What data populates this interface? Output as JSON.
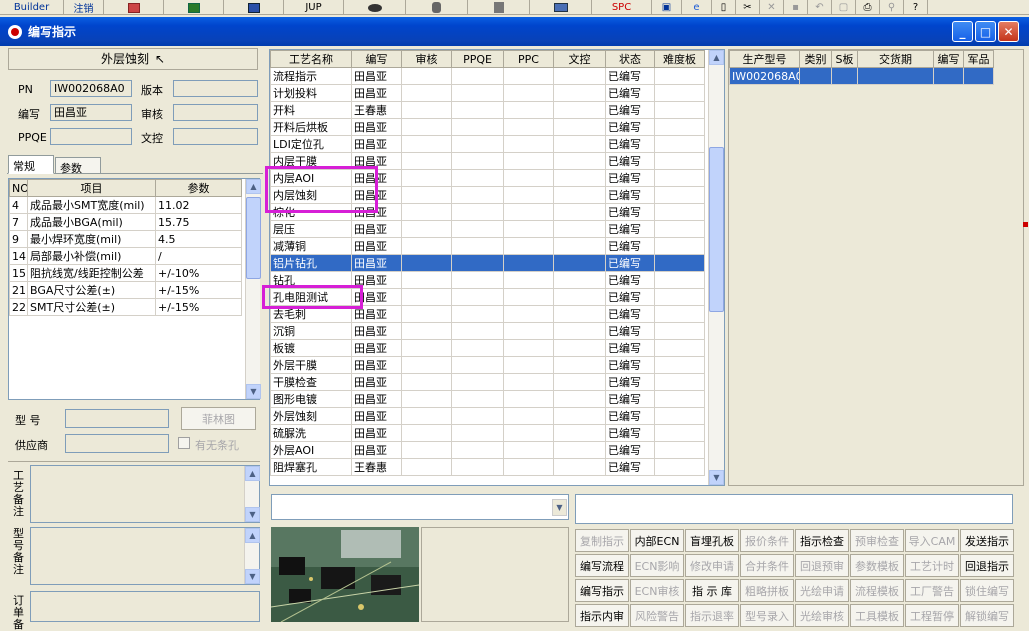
{
  "toolbar": {
    "items": [
      "Builder",
      "注销",
      "",
      "",
      "",
      "JUP",
      "",
      "",
      "",
      "",
      "SPC",
      "",
      "",
      "",
      "",
      "",
      "",
      "",
      "",
      "",
      "",
      ""
    ]
  },
  "window": {
    "title": "编写指示"
  },
  "left": {
    "header": "外层蚀刻",
    "pn_label": "PN",
    "pn_value": "IW002068A0",
    "version_label": "版本",
    "version_value": "",
    "writer_label": "编写",
    "writer_value": "田昌亚",
    "review_label": "审核",
    "review_value": "",
    "ppqe_label": "PPQE",
    "ppqe_value": "",
    "textctl_label": "文控",
    "textctl_value": "",
    "tabs": [
      "常规",
      "参数"
    ],
    "param_headers": [
      "NO",
      "项目",
      "参数"
    ],
    "params": [
      {
        "no": "4",
        "item": "成品最小SMT宽度(mil)",
        "value": "11.02"
      },
      {
        "no": "7",
        "item": "成品最小BGA(mil)",
        "value": "15.75"
      },
      {
        "no": "9",
        "item": "最小焊环宽度(mil)",
        "value": "4.5"
      },
      {
        "no": "14",
        "item": "局部最小补偿(mil)",
        "value": "/"
      },
      {
        "no": "15",
        "item": "阻抗线宽/线距控制公差",
        "value": "+/-10%"
      },
      {
        "no": "21",
        "item": "BGA尺寸公差(±)",
        "value": "+/-15%"
      },
      {
        "no": "22",
        "item": "SMT尺寸公差(±)",
        "value": "+/-15%"
      }
    ],
    "model_label": "型  号",
    "model_value": "",
    "feilin_button": "菲林图",
    "supplier_label": "供应商",
    "supplier_value": "",
    "barcode_label": "有无条孔",
    "memo1_label": "工艺备注",
    "memo2_label": "型号备注",
    "memo3_label": "订单备"
  },
  "process": {
    "headers": [
      "工艺名称",
      "编写",
      "审核",
      "PPQE",
      "PPC",
      "文控",
      "状态",
      "难度板"
    ],
    "selected_index": 11,
    "rows": [
      {
        "name": "流程指示",
        "writer": "田昌亚",
        "status": "已编写"
      },
      {
        "name": "计划投料",
        "writer": "田昌亚",
        "status": "已编写"
      },
      {
        "name": "开料",
        "writer": "王春惠",
        "status": "已编写"
      },
      {
        "name": "开料后烘板",
        "writer": "田昌亚",
        "status": "已编写"
      },
      {
        "name": "LDI定位孔",
        "writer": "田昌亚",
        "status": "已编写"
      },
      {
        "name": "内层干膜",
        "writer": "田昌亚",
        "status": "已编写"
      },
      {
        "name": "内层AOI",
        "writer": "田昌亚",
        "status": "已编写"
      },
      {
        "name": "内层蚀刻",
        "writer": "田昌亚",
        "status": "已编写"
      },
      {
        "name": "棕化",
        "writer": "田昌亚",
        "status": "已编写"
      },
      {
        "name": "层压",
        "writer": "田昌亚",
        "status": "已编写"
      },
      {
        "name": "减薄铜",
        "writer": "田昌亚",
        "status": "已编写"
      },
      {
        "name": "铝片钻孔",
        "writer": "田昌亚",
        "status": "已编写"
      },
      {
        "name": "钻孔",
        "writer": "田昌亚",
        "status": "已编写"
      },
      {
        "name": "孔电阻测试",
        "writer": "田昌亚",
        "status": "已编写"
      },
      {
        "name": "去毛刺",
        "writer": "田昌亚",
        "status": "已编写"
      },
      {
        "name": "沉铜",
        "writer": "田昌亚",
        "status": "已编写"
      },
      {
        "name": "板镀",
        "writer": "田昌亚",
        "status": "已编写"
      },
      {
        "name": "外层干膜",
        "writer": "田昌亚",
        "status": "已编写"
      },
      {
        "name": "干膜检查",
        "writer": "田昌亚",
        "status": "已编写"
      },
      {
        "name": "图形电镀",
        "writer": "田昌亚",
        "status": "已编写"
      },
      {
        "name": "外层蚀刻",
        "writer": "田昌亚",
        "status": "已编写"
      },
      {
        "name": "硫脲洗",
        "writer": "田昌亚",
        "status": "已编写"
      },
      {
        "name": "外层AOI",
        "writer": "田昌亚",
        "status": "已编写"
      },
      {
        "name": "阻焊塞孔",
        "writer": "王春惠",
        "status": "已编写"
      }
    ]
  },
  "orders": {
    "headers": [
      "生产型号",
      "类别",
      "S板",
      "交货期",
      "编写",
      "军品"
    ],
    "rows": [
      {
        "model": "IW002068A0"
      }
    ]
  },
  "actions": [
    [
      {
        "label": "复制指示",
        "enabled": false
      },
      {
        "label": "内部ECN",
        "enabled": true
      },
      {
        "label": "盲埋孔板",
        "enabled": true
      },
      {
        "label": "报价条件",
        "enabled": false
      },
      {
        "label": "指示检查",
        "enabled": true
      },
      {
        "label": "预审检查",
        "enabled": false
      },
      {
        "label": "导入CAM",
        "enabled": false
      },
      {
        "label": "发送指示",
        "enabled": true
      }
    ],
    [
      {
        "label": "编写流程",
        "enabled": true
      },
      {
        "label": "ECN影响",
        "enabled": false
      },
      {
        "label": "修改申请",
        "enabled": false
      },
      {
        "label": "合并条件",
        "enabled": false
      },
      {
        "label": "回退预审",
        "enabled": false
      },
      {
        "label": "参数模板",
        "enabled": false
      },
      {
        "label": "工艺计时",
        "enabled": false
      },
      {
        "label": "回退指示",
        "enabled": true
      }
    ],
    [
      {
        "label": "编写指示",
        "enabled": true
      },
      {
        "label": "ECN审核",
        "enabled": false
      },
      {
        "label": "指 示 库",
        "enabled": true
      },
      {
        "label": "粗略拼板",
        "enabled": false
      },
      {
        "label": "光绘申请",
        "enabled": false
      },
      {
        "label": "流程模板",
        "enabled": false
      },
      {
        "label": "工厂警告",
        "enabled": false
      },
      {
        "label": "锁住编写",
        "enabled": false
      }
    ],
    [
      {
        "label": "指示内审",
        "enabled": true
      },
      {
        "label": "风险警告",
        "enabled": false
      },
      {
        "label": "指示退率",
        "enabled": false
      },
      {
        "label": "型号录入",
        "enabled": false
      },
      {
        "label": "光绘审核",
        "enabled": false
      },
      {
        "label": "工具模板",
        "enabled": false
      },
      {
        "label": "工程暂停",
        "enabled": false
      },
      {
        "label": "解锁编写",
        "enabled": false
      }
    ]
  ]
}
